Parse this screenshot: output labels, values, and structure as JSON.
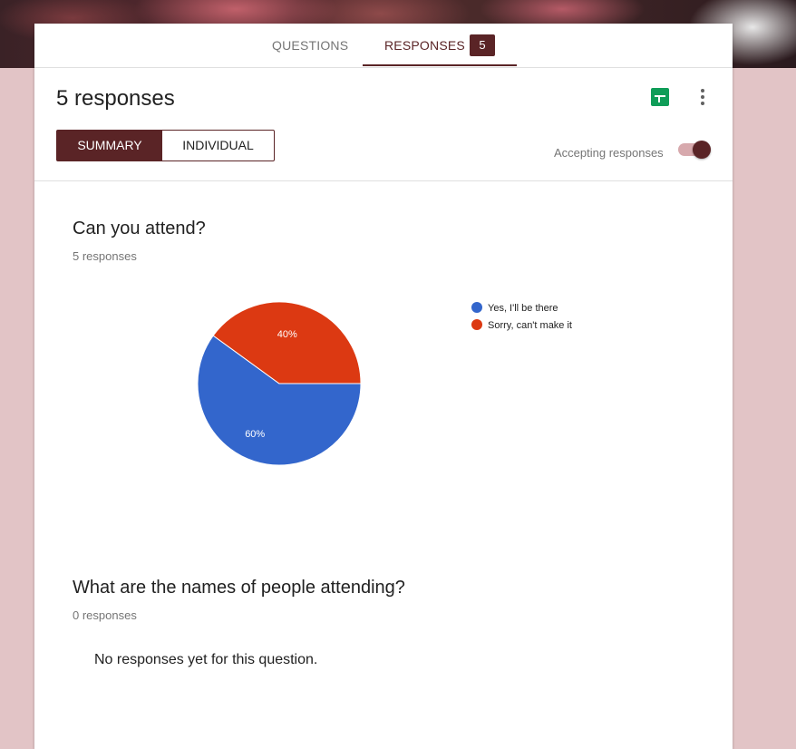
{
  "tabs": {
    "questions_label": "QUESTIONS",
    "responses_label": "RESPONSES",
    "responses_badge": "5"
  },
  "summary": {
    "title": "5 responses",
    "view_summary_label": "SUMMARY",
    "view_individual_label": "INDIVIDUAL",
    "accepting_label": "Accepting responses",
    "accepting_on": true
  },
  "icons": {
    "sheets": "sheets-icon",
    "more": "more-vert-icon"
  },
  "colors": {
    "accent": "#5a2426",
    "background": "#e2c4c6",
    "sheets_green": "#0f9d58"
  },
  "questions": [
    {
      "title": "Can you attend?",
      "count_label": "5 responses"
    },
    {
      "title": "What are the names of people attending?",
      "count_label": "0 responses",
      "empty_label": "No responses yet for this question."
    }
  ],
  "chart_data": {
    "type": "pie",
    "categories": [
      "Yes, I'll be there",
      "Sorry, can't make it"
    ],
    "values": [
      60,
      40
    ],
    "labels": [
      "60%",
      "40%"
    ],
    "colors": [
      "#3366cc",
      "#dc3912"
    ],
    "legend": "right"
  }
}
